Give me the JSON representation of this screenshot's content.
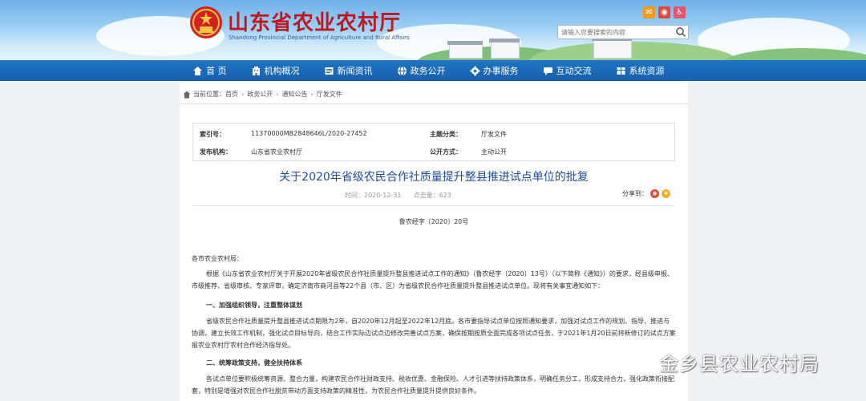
{
  "header": {
    "title": "山东省农业农村厅",
    "subtitle": "Shandong Provincial Department of Agriculture and Rural Affairs",
    "search_placeholder": "请输入您要搜索的内容",
    "tool_icons": [
      "mail-icon",
      "weibo-icon",
      "accessibility-icon"
    ]
  },
  "nav": {
    "items": [
      {
        "label": "首  页",
        "icon": "home-icon"
      },
      {
        "label": "机构概况",
        "icon": "building-icon"
      },
      {
        "label": "新闻资讯",
        "icon": "newspaper-icon"
      },
      {
        "label": "政务公开",
        "icon": "globe-icon"
      },
      {
        "label": "办事服务",
        "icon": "gear-icon"
      },
      {
        "label": "互动交流",
        "icon": "chat-icon"
      },
      {
        "label": "系统资源",
        "icon": "database-icon"
      }
    ]
  },
  "breadcrumb": {
    "prefix": "当前位置：",
    "items": [
      "首页",
      "政务公开",
      "通知公告",
      "厅发文件"
    ]
  },
  "meta": {
    "index_label": "索引号：",
    "index_value": "11370000MB2848646L/2020-27452",
    "category_label": "主题分类：",
    "category_value": "厅发文件",
    "publisher_label": "发布机构：",
    "publisher_value": "山东省农业农村厅",
    "disclosure_label": "公开方式：",
    "disclosure_value": "主动公开"
  },
  "article": {
    "title": "关于2020年省级农民合作社质量提升整县推进试点单位的批复",
    "time_label": "时间：",
    "time_value": "2020-12-31",
    "clicks_label": "点击量：",
    "clicks_value": "623",
    "share_label": "分享到：",
    "doc_number": "鲁农经字〔2020〕20号",
    "salutation": "各市农业农村局：",
    "para1": "根据《山东省农业农村厅关于开展2020年省级农民合作社质量提升整县推进试点工作的通知》（鲁农经字〔2020〕13号）（以下简称《通知》）的要求，经县级申报、市级推荐、省级审核、专家评审，确定济南市商河县等22个县（市、区）为省级农民合作社质量提升整县推进试点单位。现将有关事宜通知如下：",
    "heading1": "一、加强组织领导，注重整体谋划",
    "para2": "省级农民合作社质量提升整县推进试点期限为2年，自2020年12月起至2022年12月底。各市要指导试点单位按照通知要求，加强对试点工作的规划、指导、推进与协调，建立长效工作机制，强化试点目标导向，结合工作实际边试点边修改完善试点方案，确保按期按质全面完成各项试点任务，于2021年1月20日前将新修订的试点方案报农业农村厅农村合作经济指导处。",
    "heading2": "二、统筹政策支持，健全扶持体系",
    "para3": "各试点单位要积极统筹资源、整合力量，构建农民合作社财政支持、税收优惠、金融保险、人才引进等扶持政策体系，明确任务分工，形成支持合力，强化政策衔接配套，特别是增强对农民合作社脱贫带动方面支持政策的精准性，为农民合作社质量提升提供良好条件。"
  },
  "watermark": {
    "text": "金乡县农业农村局"
  },
  "colors": {
    "nav_bg": "#1869b6",
    "title_red": "#c0181f",
    "doc_title_blue": "#1d4e9a"
  }
}
